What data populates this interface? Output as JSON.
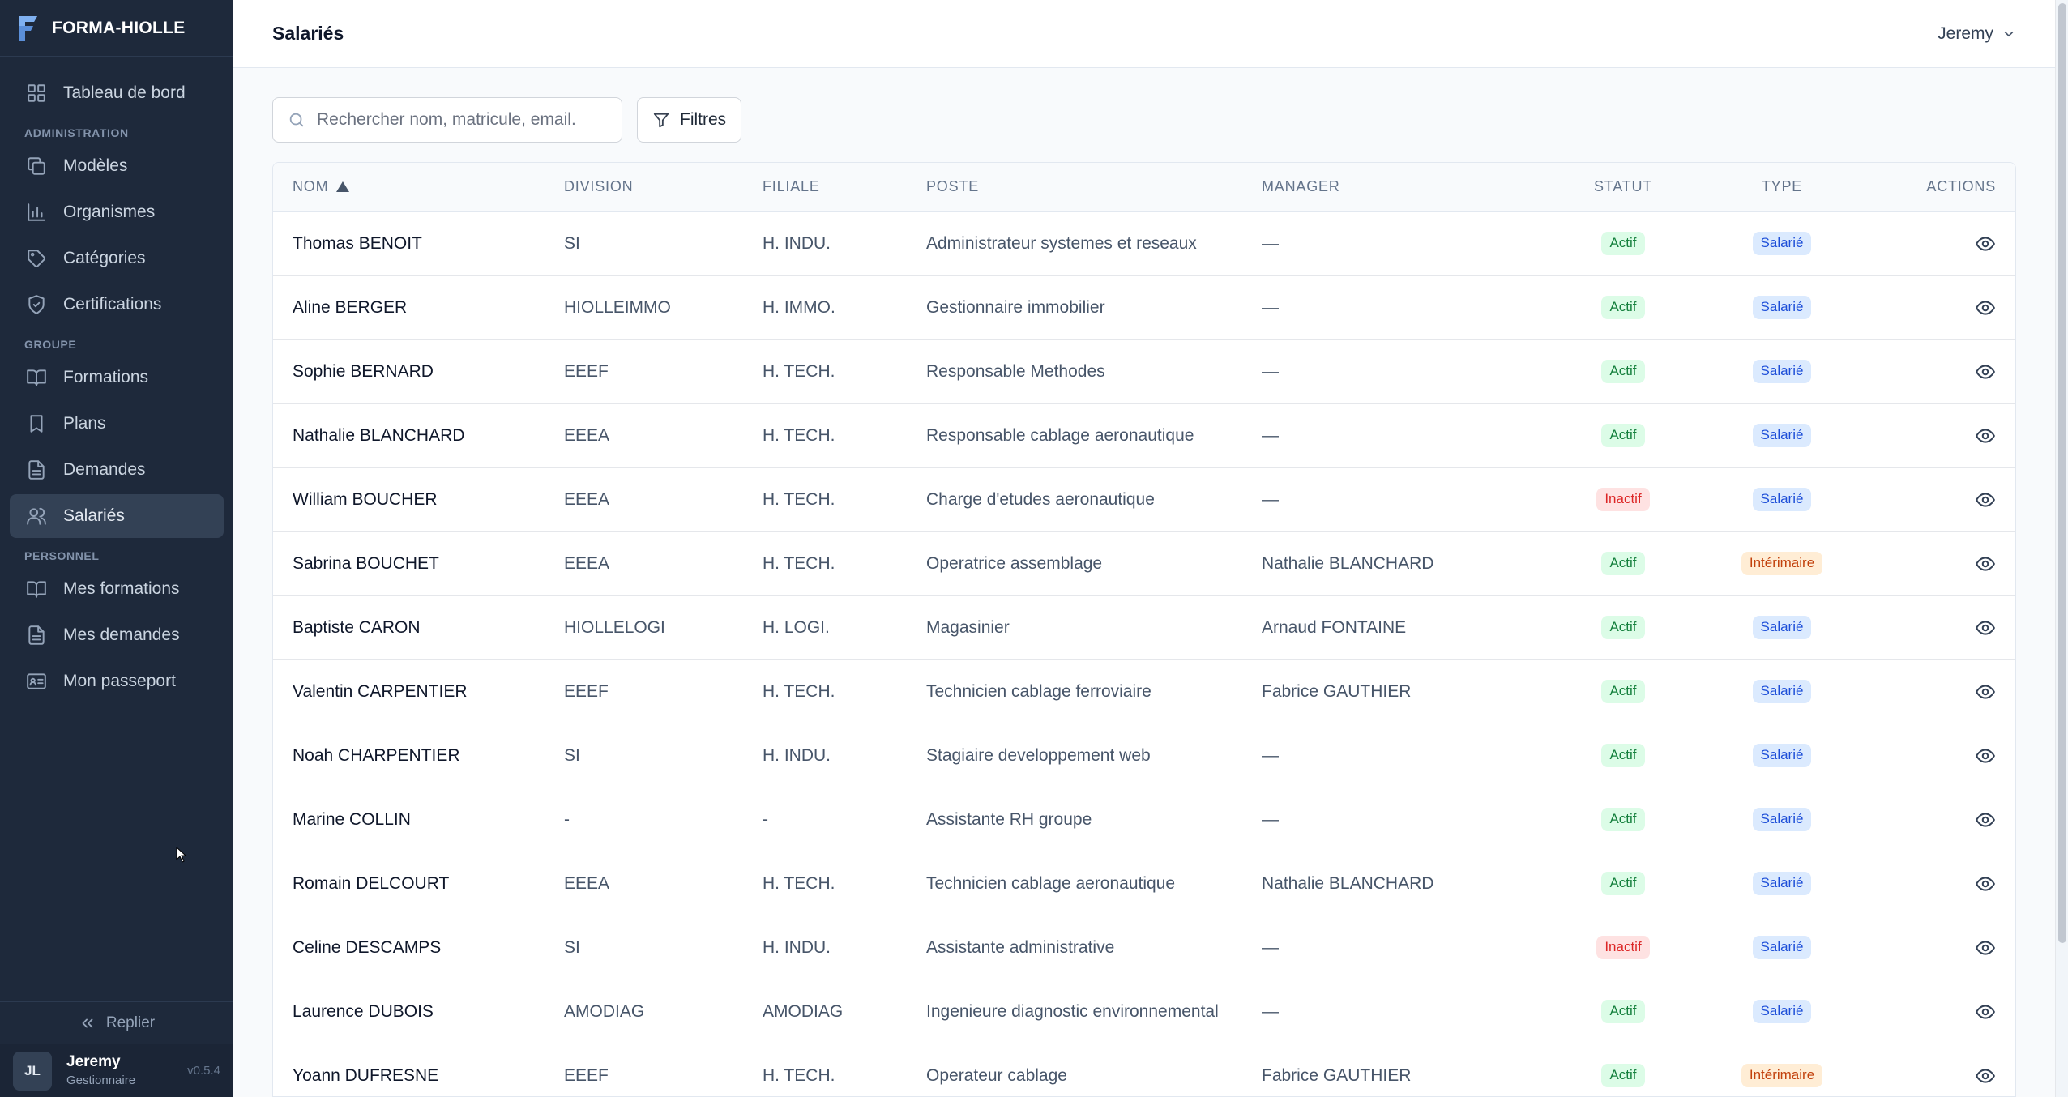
{
  "app": {
    "brand": "FORMA-HIOLLE",
    "version": "v0.5.4"
  },
  "sidebar": {
    "dashboard": {
      "label": "Tableau de bord",
      "icon": "grid-icon"
    },
    "sections": [
      {
        "title": "ADMINISTRATION",
        "items": [
          {
            "label": "Modèles",
            "icon": "copy-icon"
          },
          {
            "label": "Organismes",
            "icon": "bar-chart-icon"
          },
          {
            "label": "Catégories",
            "icon": "tag-icon"
          },
          {
            "label": "Certifications",
            "icon": "shield-check-icon"
          }
        ]
      },
      {
        "title": "GROUPE",
        "items": [
          {
            "label": "Formations",
            "icon": "book-open-icon"
          },
          {
            "label": "Plans",
            "icon": "bookmark-icon"
          },
          {
            "label": "Demandes",
            "icon": "file-text-icon"
          },
          {
            "label": "Salariés",
            "icon": "users-icon",
            "active": true
          }
        ]
      },
      {
        "title": "PERSONNEL",
        "items": [
          {
            "label": "Mes formations",
            "icon": "book-open-icon"
          },
          {
            "label": "Mes demandes",
            "icon": "file-text-icon"
          },
          {
            "label": "Mon passeport",
            "icon": "id-card-icon"
          }
        ]
      }
    ],
    "collapse_label": "Replier",
    "user": {
      "initials": "JL",
      "name": "Jeremy",
      "role": "Gestionnaire"
    }
  },
  "header": {
    "title": "Salariés",
    "user_menu": "Jeremy"
  },
  "toolbar": {
    "search_placeholder": "Rechercher nom, matricule, email.",
    "filters_label": "Filtres"
  },
  "table": {
    "columns": {
      "nom": "NOM",
      "division": "DIVISION",
      "filiale": "FILIALE",
      "poste": "POSTE",
      "manager": "MANAGER",
      "statut": "STATUT",
      "type": "TYPE",
      "actions": "ACTIONS"
    },
    "sort": {
      "column": "nom",
      "direction": "asc"
    },
    "rows": [
      {
        "nom": "Thomas BENOIT",
        "division": "SI",
        "filiale": "H. INDU.",
        "poste": "Administrateur systemes et reseaux",
        "manager": "—",
        "statut": "Actif",
        "type": "Salarié"
      },
      {
        "nom": "Aline BERGER",
        "division": "HIOLLEIMMO",
        "filiale": "H. IMMO.",
        "poste": "Gestionnaire immobilier",
        "manager": "—",
        "statut": "Actif",
        "type": "Salarié"
      },
      {
        "nom": "Sophie BERNARD",
        "division": "EEEF",
        "filiale": "H. TECH.",
        "poste": "Responsable Methodes",
        "manager": "—",
        "statut": "Actif",
        "type": "Salarié"
      },
      {
        "nom": "Nathalie BLANCHARD",
        "division": "EEEA",
        "filiale": "H. TECH.",
        "poste": "Responsable cablage aeronautique",
        "manager": "—",
        "statut": "Actif",
        "type": "Salarié"
      },
      {
        "nom": "William BOUCHER",
        "division": "EEEA",
        "filiale": "H. TECH.",
        "poste": "Charge d'etudes aeronautique",
        "manager": "—",
        "statut": "Inactif",
        "type": "Salarié"
      },
      {
        "nom": "Sabrina BOUCHET",
        "division": "EEEA",
        "filiale": "H. TECH.",
        "poste": "Operatrice assemblage",
        "manager": "Nathalie BLANCHARD",
        "statut": "Actif",
        "type": "Intérimaire"
      },
      {
        "nom": "Baptiste CARON",
        "division": "HIOLLELOGI",
        "filiale": "H. LOGI.",
        "poste": "Magasinier",
        "manager": "Arnaud FONTAINE",
        "statut": "Actif",
        "type": "Salarié"
      },
      {
        "nom": "Valentin CARPENTIER",
        "division": "EEEF",
        "filiale": "H. TECH.",
        "poste": "Technicien cablage ferroviaire",
        "manager": "Fabrice GAUTHIER",
        "statut": "Actif",
        "type": "Salarié"
      },
      {
        "nom": "Noah CHARPENTIER",
        "division": "SI",
        "filiale": "H. INDU.",
        "poste": "Stagiaire developpement web",
        "manager": "—",
        "statut": "Actif",
        "type": "Salarié"
      },
      {
        "nom": "Marine COLLIN",
        "division": "-",
        "filiale": "-",
        "poste": "Assistante RH groupe",
        "manager": "—",
        "statut": "Actif",
        "type": "Salarié"
      },
      {
        "nom": "Romain DELCOURT",
        "division": "EEEA",
        "filiale": "H. TECH.",
        "poste": "Technicien cablage aeronautique",
        "manager": "Nathalie BLANCHARD",
        "statut": "Actif",
        "type": "Salarié"
      },
      {
        "nom": "Celine DESCAMPS",
        "division": "SI",
        "filiale": "H. INDU.",
        "poste": "Assistante administrative",
        "manager": "—",
        "statut": "Inactif",
        "type": "Salarié"
      },
      {
        "nom": "Laurence DUBOIS",
        "division": "AMODIAG",
        "filiale": "AMODIAG",
        "poste": "Ingenieure diagnostic environnemental",
        "manager": "—",
        "statut": "Actif",
        "type": "Salarié"
      },
      {
        "nom": "Yoann DUFRESNE",
        "division": "EEEF",
        "filiale": "H. TECH.",
        "poste": "Operateur cablage",
        "manager": "Fabrice GAUTHIER",
        "statut": "Actif",
        "type": "Intérimaire"
      }
    ]
  }
}
